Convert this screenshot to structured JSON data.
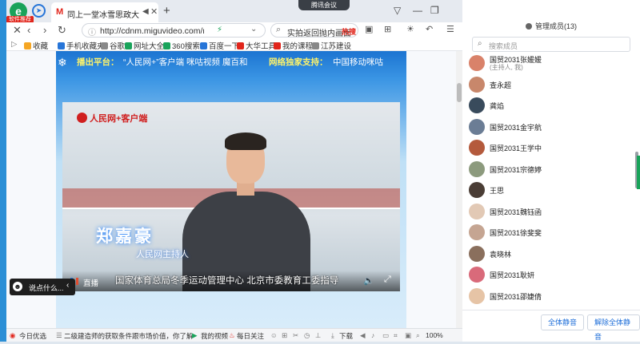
{
  "browser": {
    "logo_text": "e",
    "logo_badge": "软件推荐",
    "meeting_pill": "腾讯会议",
    "tab": {
      "favicon": "M",
      "title": "同上一堂冰雪思政大课",
      "mute_icon": "speaker-mute-icon",
      "close": "✕"
    },
    "new_tab": "+",
    "address": {
      "url": "http://cdnm.miguvideo.com/mg",
      "drop": "⌄"
    },
    "search": {
      "text": "实拍返回抛内画面",
      "hot": "热搜"
    },
    "bookmarks": [
      {
        "label": "收藏",
        "color": "#f5a623"
      },
      {
        "label": "手机收藏夹",
        "color": "#2775d8"
      },
      {
        "label": "谷歌",
        "color": "#888888"
      },
      {
        "label": "网址大全",
        "color": "#19a35a"
      },
      {
        "label": "360搜索",
        "color": "#19a35a"
      },
      {
        "label": "百度一下",
        "color": "#2775d8"
      },
      {
        "label": "大华工具",
        "color": "#e1251b"
      },
      {
        "label": "我的课程",
        "color": "#e1251b"
      },
      {
        "label": "江苏建设",
        "color": "#888888"
      }
    ]
  },
  "page": {
    "platform_label": "播出平台：",
    "platform_items": "“人民网+”客户端   咪咕视频   魔百和",
    "network_label": "网络独家支持：",
    "network_value": "中国移动咪咕",
    "video": {
      "channel_logo": "人民网+客户端",
      "host_name": "郑嘉豪",
      "host_role": "人民网主持人",
      "live_label": "直播",
      "subtitle": "国家体育总局冬季运动管理中心  北京市委教育工委指导"
    },
    "chat": {
      "placeholder": "说点什么...",
      "close": "‹"
    }
  },
  "status": {
    "items": [
      "今日优选",
      "二级建造师的获取条件跟市场价值，你了解的有多少",
      "我的视频",
      "每日关注",
      "下载",
      "100%"
    ]
  },
  "panel": {
    "title": "管理成员(13)",
    "search_placeholder": "搜索成员",
    "members": [
      {
        "name": "国贸2031张媛媛",
        "sub": "(主持人, 我)",
        "color": "#d9826a"
      },
      {
        "name": "查永超",
        "sub": "",
        "color": "#c8876b"
      },
      {
        "name": "龚焰",
        "sub": "",
        "color": "#394b5c"
      },
      {
        "name": "国贸2031金宇航",
        "sub": "",
        "color": "#6b7d95"
      },
      {
        "name": "国贸2031王学中",
        "sub": "",
        "color": "#b45a3c"
      },
      {
        "name": "国贸2031宗德婷",
        "sub": "",
        "color": "#8c9a7d"
      },
      {
        "name": "王思",
        "sub": "",
        "color": "#4a3d35"
      },
      {
        "name": "国贸2031魏钰函",
        "sub": "",
        "color": "#e2c9b5"
      },
      {
        "name": "国贸2031徐斐斐",
        "sub": "",
        "color": "#c5a592"
      },
      {
        "name": "袁晓林",
        "sub": "",
        "color": "#8a6f5d"
      },
      {
        "name": "国贸2031耿妍",
        "sub": "",
        "color": "#d96a7a"
      },
      {
        "name": "国贸2031邵婕倩",
        "sub": "",
        "color": "#e6c4a6"
      }
    ],
    "mute_all": "全体静音",
    "unmute_all": "解除全体静音"
  }
}
